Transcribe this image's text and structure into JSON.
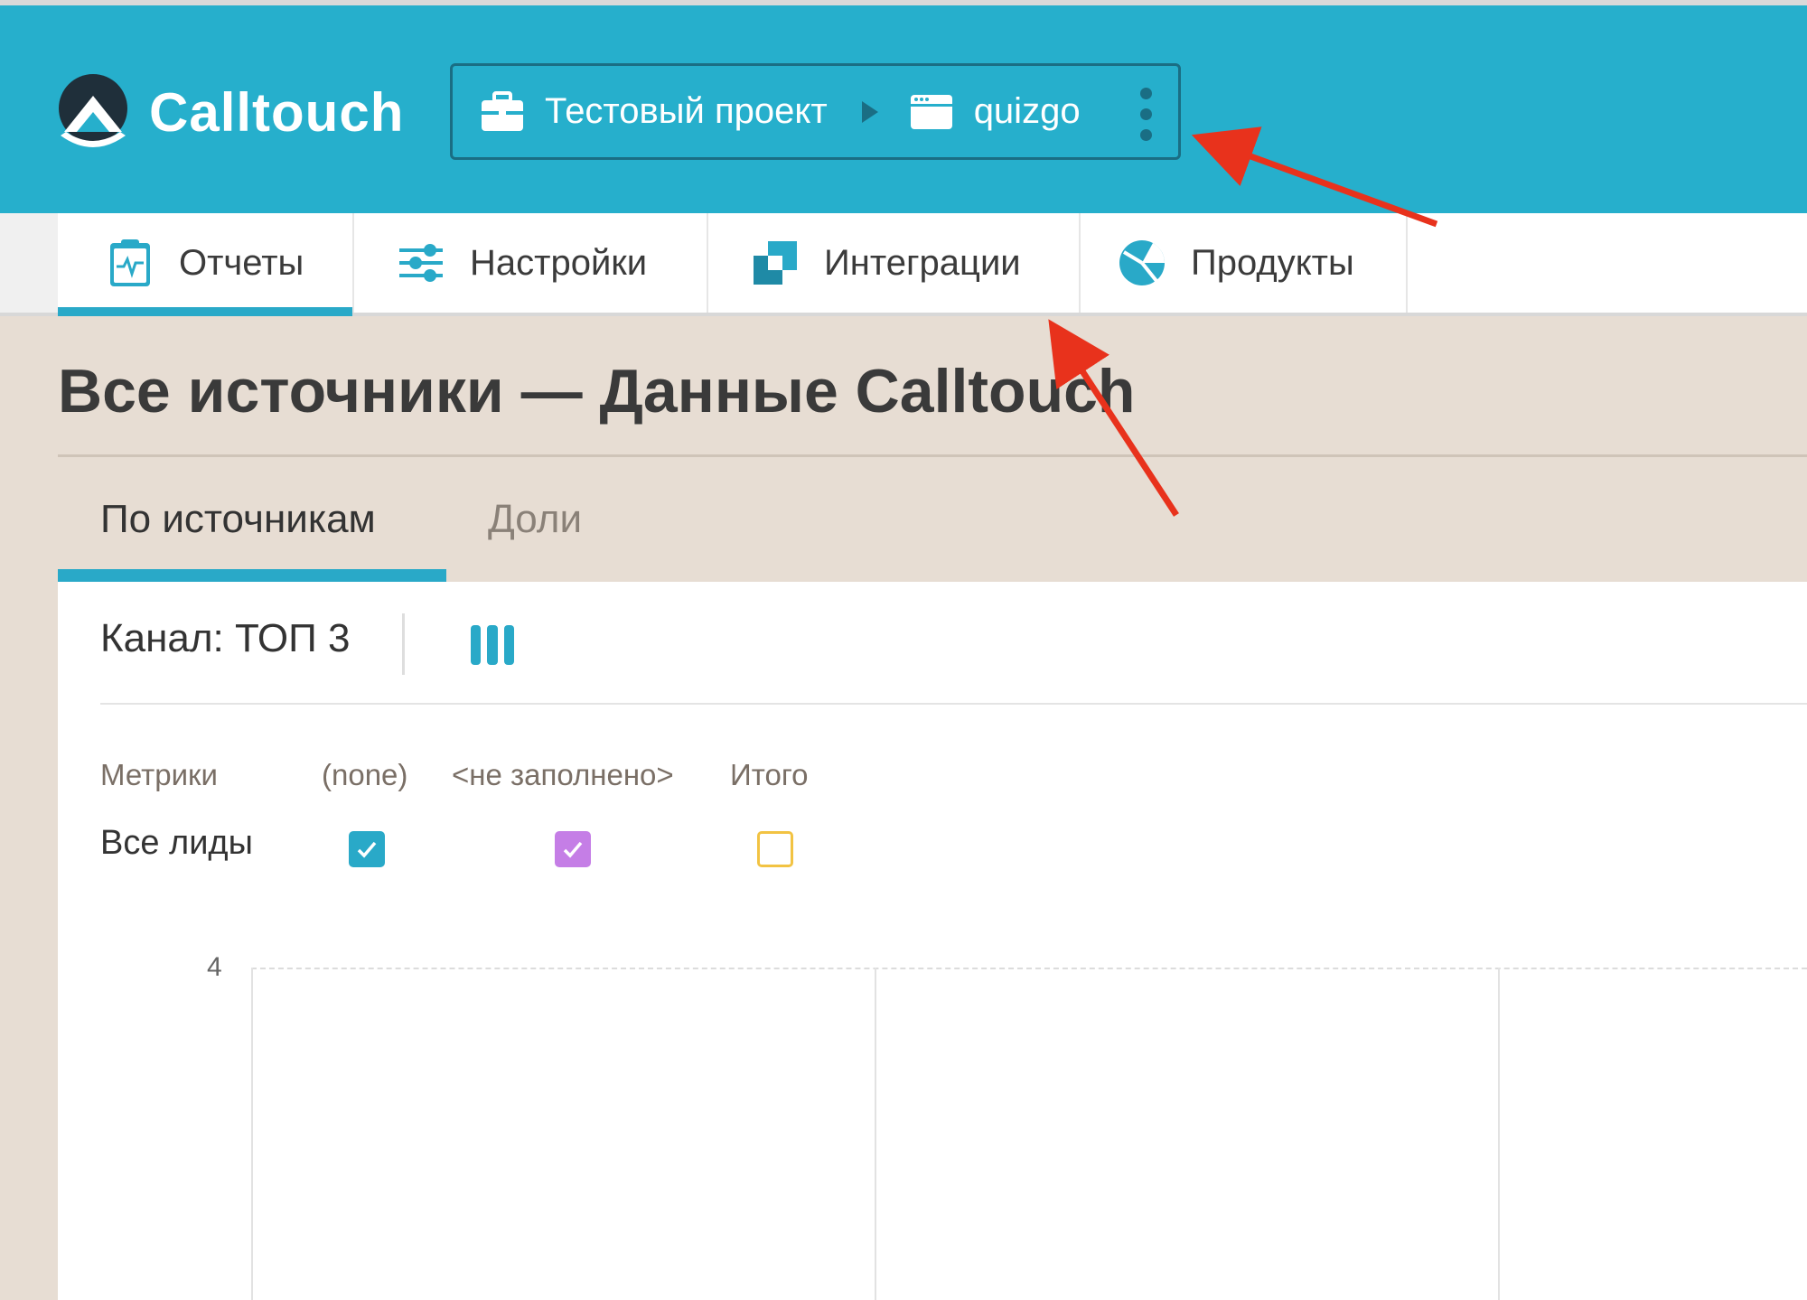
{
  "header": {
    "brand": "Calltouch",
    "breadcrumb": {
      "project": "Тестовый проект",
      "site": "quizgo"
    }
  },
  "nav": {
    "items": [
      {
        "label": "Отчеты",
        "icon": "report-clipboard-icon",
        "active": true
      },
      {
        "label": "Настройки",
        "icon": "sliders-icon",
        "active": false
      },
      {
        "label": "Интеграции",
        "icon": "integration-squares-icon",
        "active": false
      },
      {
        "label": "Продукты",
        "icon": "products-pie-icon",
        "active": false
      }
    ]
  },
  "page": {
    "title": "Все источники — Данные Calltouch",
    "tabs": [
      {
        "label": "По источникам",
        "active": true
      },
      {
        "label": "Доли",
        "active": false
      }
    ]
  },
  "toolbar": {
    "channel": "Канал: ТОП 3",
    "columns_icon": "columns-icon"
  },
  "metrics": {
    "header_label": "Метрики",
    "columns": [
      "(none)",
      "<не заполнено>",
      "Итого"
    ],
    "row_label": "Все лиды",
    "checked": [
      true,
      true,
      false
    ]
  },
  "chart": {
    "y_top_tick": "4"
  },
  "colors": {
    "header_bg": "#26afcc",
    "accent": "#29a9c8",
    "series_none": "#29a9c8",
    "series_empty": "#c57ee6",
    "series_total": "#f2c343",
    "annotation_arrow": "#e8321c"
  }
}
